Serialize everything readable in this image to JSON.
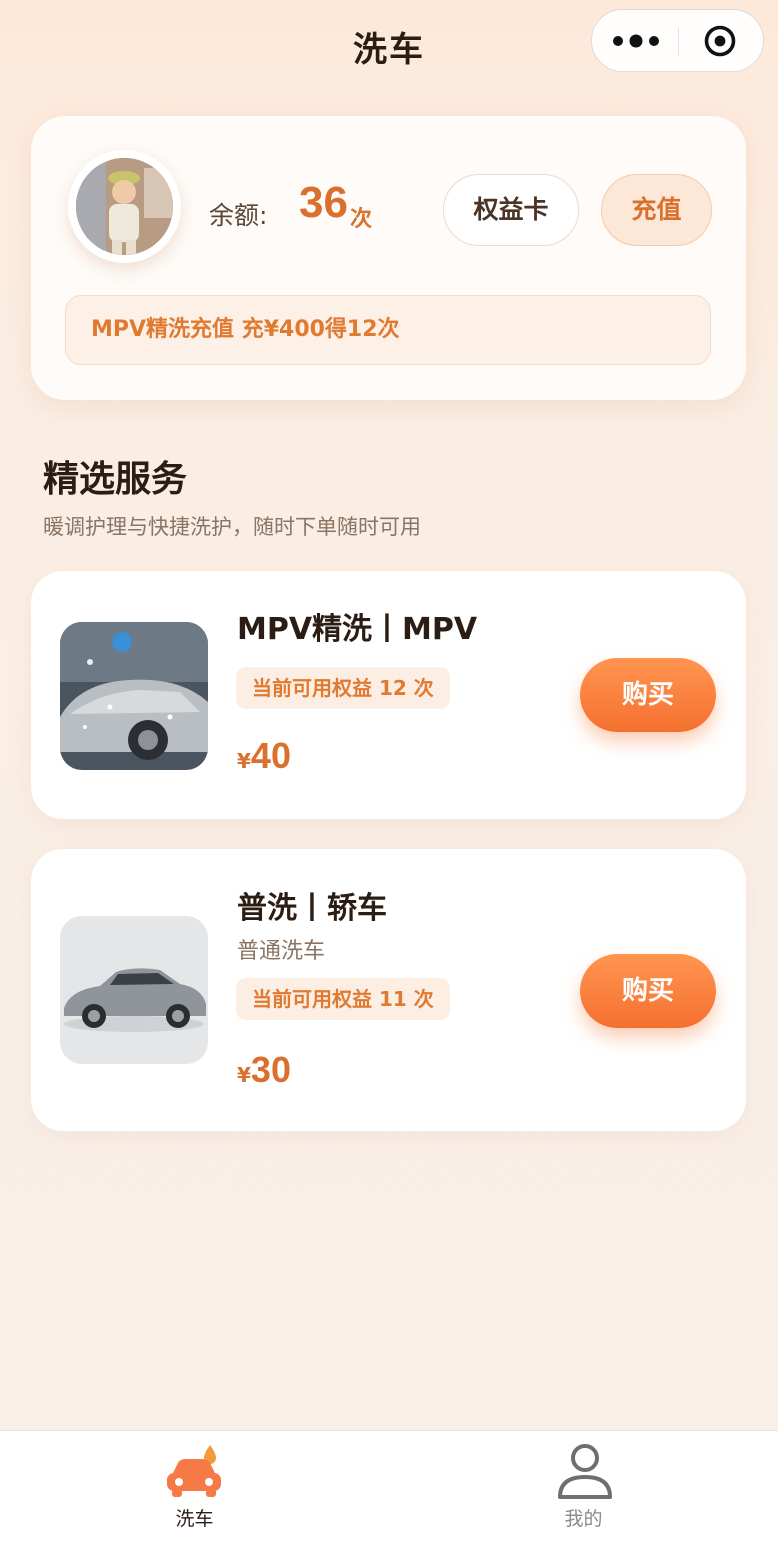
{
  "nav": {
    "title": "洗车",
    "capsule_icons": [
      "more-dots-icon",
      "target-icon"
    ]
  },
  "account": {
    "balance_label": "余额:",
    "balance_value": "36",
    "balance_unit": "次",
    "rights_button": "权益卡",
    "recharge_button": "充值",
    "promo_text": "MPV精洗充值 充¥400得12次"
  },
  "section": {
    "title": "精选服务",
    "subtitle": "暖调护理与快捷洗护，随时下单随时可用"
  },
  "services": [
    {
      "title": "MPV精洗丨MPV",
      "badge": "当前可用权益 12 次",
      "currency": "¥",
      "price": "40",
      "buy_label": "购买"
    },
    {
      "title": "普洗丨轿车",
      "desc": "普通洗车",
      "badge": "当前可用权益 11 次",
      "currency": "¥",
      "price": "30",
      "buy_label": "购买"
    }
  ],
  "tabbar": {
    "items": [
      {
        "label": "洗车",
        "icon": "car-wash-icon",
        "active": true
      },
      {
        "label": "我的",
        "icon": "user-icon",
        "active": false
      }
    ]
  },
  "colors": {
    "accent": "#d9702d",
    "button_orange": "#f5702f",
    "badge_bg": "#fdeee3"
  }
}
